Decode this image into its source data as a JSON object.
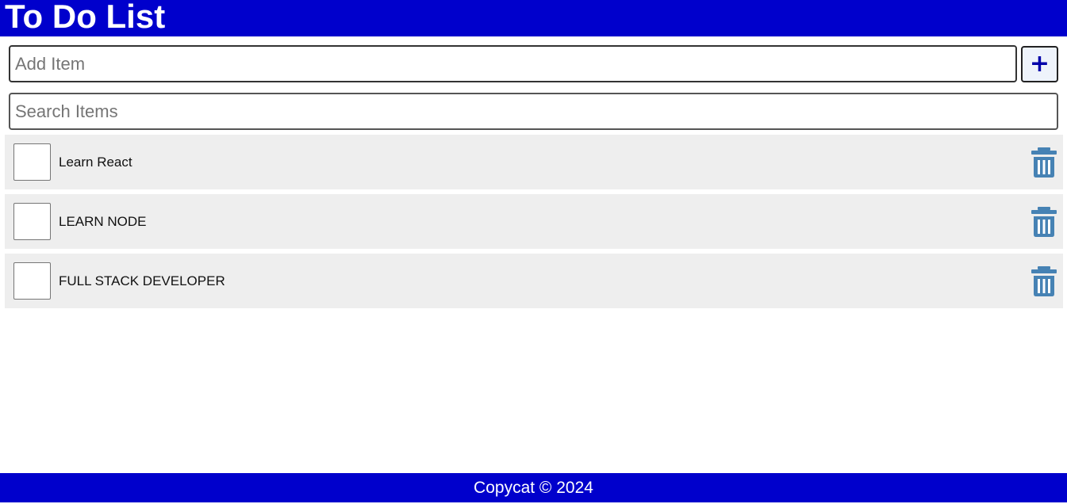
{
  "header": {
    "title": "To Do List"
  },
  "add_form": {
    "placeholder": "Add Item",
    "button_label": "+"
  },
  "search": {
    "placeholder": "Search Items"
  },
  "items": [
    {
      "label": "Learn React",
      "checked": false
    },
    {
      "label": "LEARN NODE",
      "checked": false
    },
    {
      "label": "FULL STACK DEVELOPER",
      "checked": false
    }
  ],
  "footer": {
    "text": "Copycat © 2024"
  },
  "colors": {
    "header_bg": "#0000cc",
    "item_bg": "#eeeeee",
    "trash_icon": "#4682b4",
    "add_button_text": "#0000aa"
  },
  "icons": {
    "delete": "trash-icon",
    "add": "plus-icon"
  }
}
